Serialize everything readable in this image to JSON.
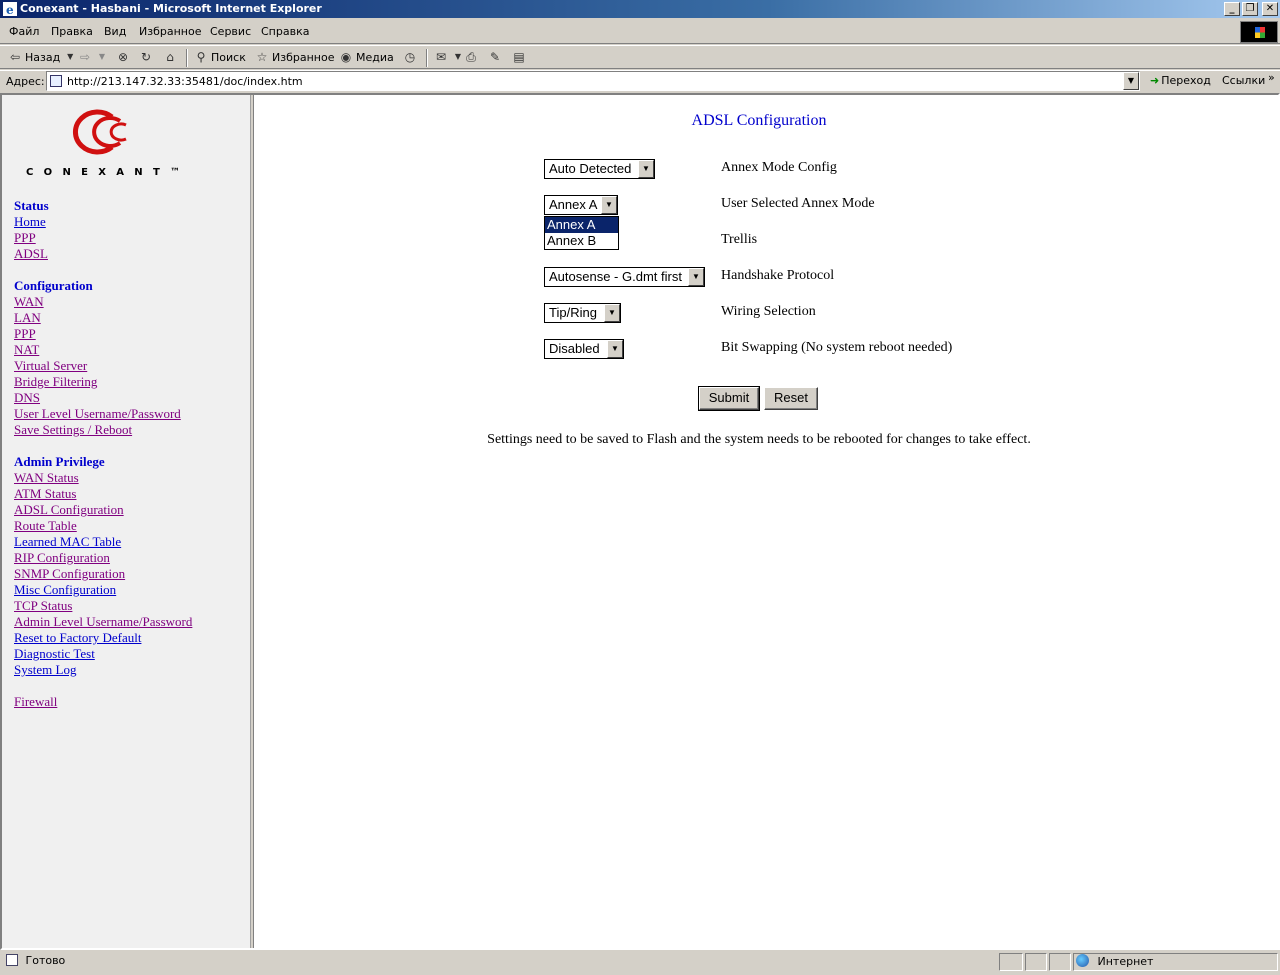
{
  "window": {
    "title": "Conexant - Hasbani - Microsoft Internet Explorer"
  },
  "menu": {
    "items": [
      "Файл",
      "Правка",
      "Вид",
      "Избранное",
      "Сервис",
      "Справка"
    ]
  },
  "toolbar": {
    "back": "Назад",
    "search": "Поиск",
    "favorites": "Избранное",
    "media": "Медиа"
  },
  "address": {
    "label": "Адрес:",
    "url": "http://213.147.32.33:35481/doc/index.htm",
    "go": "Переход",
    "links": "Ссылки"
  },
  "logo": {
    "text": "CONEXANT™"
  },
  "sidebar": {
    "status": {
      "heading": "Status",
      "links": [
        "Home",
        "PPP",
        "ADSL"
      ]
    },
    "configuration": {
      "heading": "Configuration",
      "links": [
        "WAN",
        "LAN",
        "PPP",
        "NAT",
        "Virtual Server",
        "Bridge Filtering",
        "DNS",
        "User Level Username/Password",
        "Save Settings / Reboot"
      ]
    },
    "admin": {
      "heading": "Admin Privilege",
      "links": [
        "WAN Status",
        "ATM Status",
        "ADSL Configuration",
        "Route Table",
        "Learned MAC Table",
        "RIP Configuration",
        "SNMP Configuration",
        "Misc Configuration",
        "TCP Status",
        "Admin Level Username/Password",
        "Reset to Factory Default",
        "Diagnostic Test",
        "System Log"
      ]
    },
    "firewall": "Firewall"
  },
  "main": {
    "title": "ADSL Configuration",
    "rows": [
      {
        "value": "Auto Detected",
        "label": "Annex Mode Config"
      },
      {
        "value": "Annex A",
        "label": "User Selected Annex Mode"
      },
      {
        "value": "",
        "label": "Trellis"
      },
      {
        "value": "Autosense - G.dmt first",
        "label": "Handshake Protocol"
      },
      {
        "value": "Tip/Ring",
        "label": "Wiring Selection"
      },
      {
        "value": "Disabled",
        "label": "Bit Swapping (No system reboot needed)"
      }
    ],
    "dropdown_options": [
      "Annex A",
      "Annex B"
    ],
    "submit": "Submit",
    "reset": "Reset",
    "note": "Settings need to be saved to Flash and the system needs to be rebooted for changes to take effect."
  },
  "status": {
    "text": "Готово",
    "zone": "Интернет"
  }
}
